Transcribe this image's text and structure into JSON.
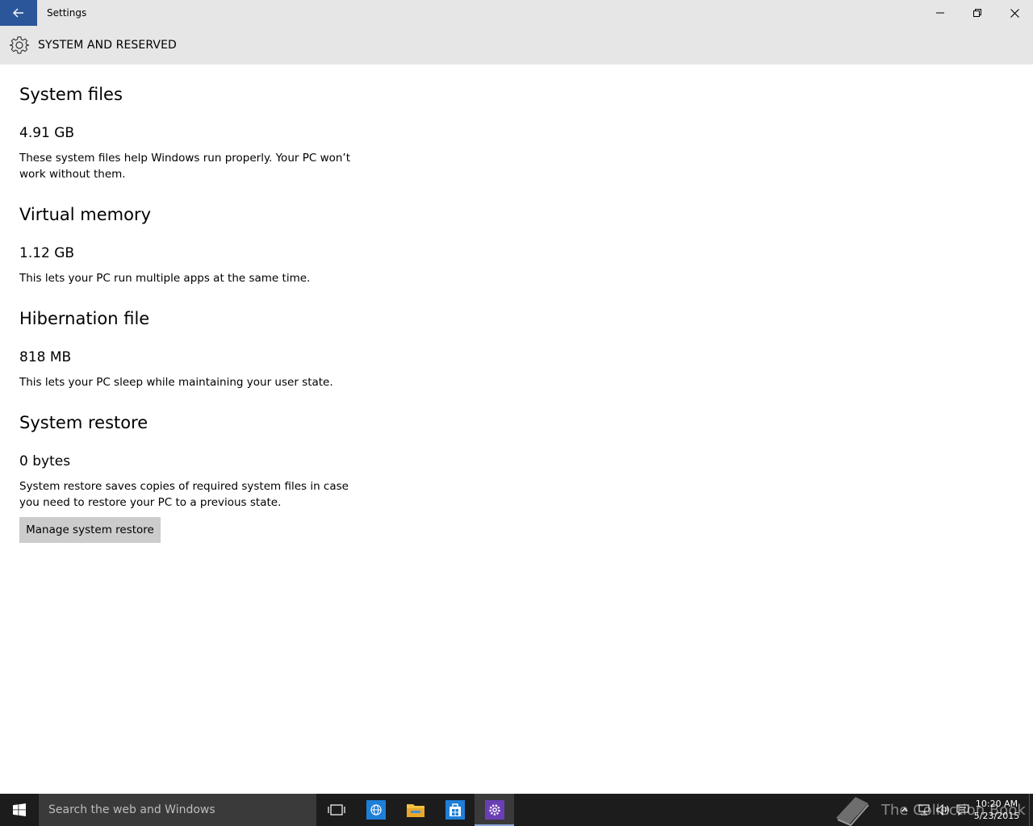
{
  "window": {
    "title": "Settings"
  },
  "header": {
    "title": "SYSTEM AND RESERVED"
  },
  "sections": [
    {
      "title": "System files",
      "size": "4.91 GB",
      "description": "These system files help Windows run properly. Your PC won’t work without them."
    },
    {
      "title": "Virtual memory",
      "size": "1.12 GB",
      "description": "This lets your PC run multiple apps at the same time."
    },
    {
      "title": "Hibernation file",
      "size": "818 MB",
      "description": "This lets your PC sleep while maintaining your user state."
    },
    {
      "title": "System restore",
      "size": "0 bytes",
      "description": "System restore saves copies of required system files in case you need to restore your PC to a previous state."
    }
  ],
  "manage_button": "Manage system restore",
  "taskbar": {
    "search_placeholder": "Search the web and Windows",
    "watermark": "The Collection Book",
    "time": "10:20 AM",
    "date": "5/23/2015"
  },
  "colors": {
    "accent": "#2b579a",
    "titlebar": "#e6e6e6",
    "taskbar": "#1c1c1c",
    "button": "#cccccc"
  }
}
